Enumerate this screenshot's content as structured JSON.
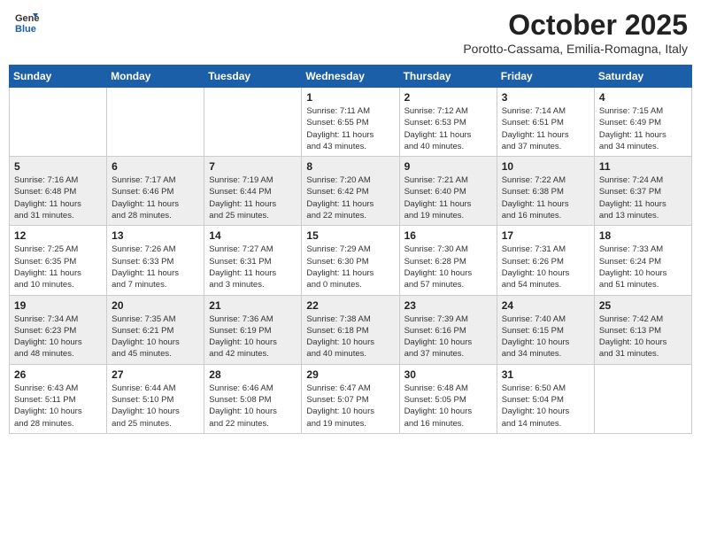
{
  "header": {
    "logo": {
      "general": "General",
      "blue": "Blue"
    },
    "title": "October 2025",
    "location": "Porotto-Cassama, Emilia-Romagna, Italy"
  },
  "weekdays": [
    "Sunday",
    "Monday",
    "Tuesday",
    "Wednesday",
    "Thursday",
    "Friday",
    "Saturday"
  ],
  "weeks": [
    [
      {
        "day": "",
        "info": ""
      },
      {
        "day": "",
        "info": ""
      },
      {
        "day": "",
        "info": ""
      },
      {
        "day": "1",
        "info": "Sunrise: 7:11 AM\nSunset: 6:55 PM\nDaylight: 11 hours\nand 43 minutes."
      },
      {
        "day": "2",
        "info": "Sunrise: 7:12 AM\nSunset: 6:53 PM\nDaylight: 11 hours\nand 40 minutes."
      },
      {
        "day": "3",
        "info": "Sunrise: 7:14 AM\nSunset: 6:51 PM\nDaylight: 11 hours\nand 37 minutes."
      },
      {
        "day": "4",
        "info": "Sunrise: 7:15 AM\nSunset: 6:49 PM\nDaylight: 11 hours\nand 34 minutes."
      }
    ],
    [
      {
        "day": "5",
        "info": "Sunrise: 7:16 AM\nSunset: 6:48 PM\nDaylight: 11 hours\nand 31 minutes."
      },
      {
        "day": "6",
        "info": "Sunrise: 7:17 AM\nSunset: 6:46 PM\nDaylight: 11 hours\nand 28 minutes."
      },
      {
        "day": "7",
        "info": "Sunrise: 7:19 AM\nSunset: 6:44 PM\nDaylight: 11 hours\nand 25 minutes."
      },
      {
        "day": "8",
        "info": "Sunrise: 7:20 AM\nSunset: 6:42 PM\nDaylight: 11 hours\nand 22 minutes."
      },
      {
        "day": "9",
        "info": "Sunrise: 7:21 AM\nSunset: 6:40 PM\nDaylight: 11 hours\nand 19 minutes."
      },
      {
        "day": "10",
        "info": "Sunrise: 7:22 AM\nSunset: 6:38 PM\nDaylight: 11 hours\nand 16 minutes."
      },
      {
        "day": "11",
        "info": "Sunrise: 7:24 AM\nSunset: 6:37 PM\nDaylight: 11 hours\nand 13 minutes."
      }
    ],
    [
      {
        "day": "12",
        "info": "Sunrise: 7:25 AM\nSunset: 6:35 PM\nDaylight: 11 hours\nand 10 minutes."
      },
      {
        "day": "13",
        "info": "Sunrise: 7:26 AM\nSunset: 6:33 PM\nDaylight: 11 hours\nand 7 minutes."
      },
      {
        "day": "14",
        "info": "Sunrise: 7:27 AM\nSunset: 6:31 PM\nDaylight: 11 hours\nand 3 minutes."
      },
      {
        "day": "15",
        "info": "Sunrise: 7:29 AM\nSunset: 6:30 PM\nDaylight: 11 hours\nand 0 minutes."
      },
      {
        "day": "16",
        "info": "Sunrise: 7:30 AM\nSunset: 6:28 PM\nDaylight: 10 hours\nand 57 minutes."
      },
      {
        "day": "17",
        "info": "Sunrise: 7:31 AM\nSunset: 6:26 PM\nDaylight: 10 hours\nand 54 minutes."
      },
      {
        "day": "18",
        "info": "Sunrise: 7:33 AM\nSunset: 6:24 PM\nDaylight: 10 hours\nand 51 minutes."
      }
    ],
    [
      {
        "day": "19",
        "info": "Sunrise: 7:34 AM\nSunset: 6:23 PM\nDaylight: 10 hours\nand 48 minutes."
      },
      {
        "day": "20",
        "info": "Sunrise: 7:35 AM\nSunset: 6:21 PM\nDaylight: 10 hours\nand 45 minutes."
      },
      {
        "day": "21",
        "info": "Sunrise: 7:36 AM\nSunset: 6:19 PM\nDaylight: 10 hours\nand 42 minutes."
      },
      {
        "day": "22",
        "info": "Sunrise: 7:38 AM\nSunset: 6:18 PM\nDaylight: 10 hours\nand 40 minutes."
      },
      {
        "day": "23",
        "info": "Sunrise: 7:39 AM\nSunset: 6:16 PM\nDaylight: 10 hours\nand 37 minutes."
      },
      {
        "day": "24",
        "info": "Sunrise: 7:40 AM\nSunset: 6:15 PM\nDaylight: 10 hours\nand 34 minutes."
      },
      {
        "day": "25",
        "info": "Sunrise: 7:42 AM\nSunset: 6:13 PM\nDaylight: 10 hours\nand 31 minutes."
      }
    ],
    [
      {
        "day": "26",
        "info": "Sunrise: 6:43 AM\nSunset: 5:11 PM\nDaylight: 10 hours\nand 28 minutes."
      },
      {
        "day": "27",
        "info": "Sunrise: 6:44 AM\nSunset: 5:10 PM\nDaylight: 10 hours\nand 25 minutes."
      },
      {
        "day": "28",
        "info": "Sunrise: 6:46 AM\nSunset: 5:08 PM\nDaylight: 10 hours\nand 22 minutes."
      },
      {
        "day": "29",
        "info": "Sunrise: 6:47 AM\nSunset: 5:07 PM\nDaylight: 10 hours\nand 19 minutes."
      },
      {
        "day": "30",
        "info": "Sunrise: 6:48 AM\nSunset: 5:05 PM\nDaylight: 10 hours\nand 16 minutes."
      },
      {
        "day": "31",
        "info": "Sunrise: 6:50 AM\nSunset: 5:04 PM\nDaylight: 10 hours\nand 14 minutes."
      },
      {
        "day": "",
        "info": ""
      }
    ]
  ]
}
